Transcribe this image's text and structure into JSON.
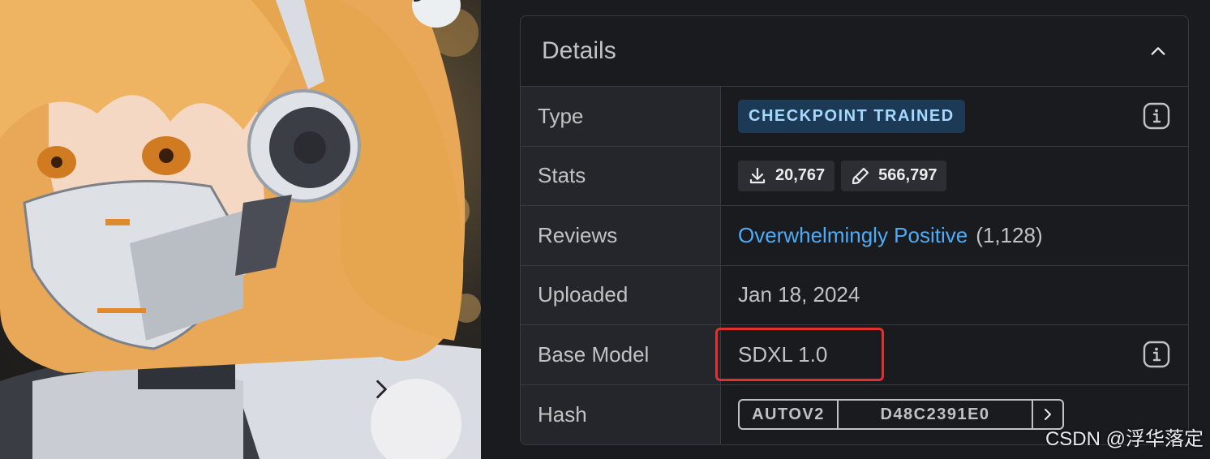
{
  "details": {
    "title": "Details",
    "rows": {
      "type": {
        "label": "Type",
        "badge": "CHECKPOINT TRAINED"
      },
      "stats": {
        "label": "Stats",
        "downloads": "20,767",
        "generations": "566,797"
      },
      "reviews": {
        "label": "Reviews",
        "rating": "Overwhelmingly Positive",
        "count": "(1,128)"
      },
      "uploaded": {
        "label": "Uploaded",
        "date": "Jan 18, 2024"
      },
      "base_model": {
        "label": "Base Model",
        "value": "SDXL 1.0"
      },
      "hash": {
        "label": "Hash",
        "type": "AUTOV2",
        "value": "D48C2391E0"
      }
    }
  },
  "watermark": "CSDN @浮华落定",
  "icons": {
    "edit": "brush-icon",
    "next": "chevron-right-icon",
    "collapse": "chevron-up-icon",
    "info": "info-icon",
    "download": "download-icon",
    "generations": "brush-icon"
  },
  "colors": {
    "accent_link": "#4dabf7",
    "badge_bg": "#1c3a56",
    "badge_text": "#a5d8ff",
    "highlight_border": "#e03131"
  }
}
